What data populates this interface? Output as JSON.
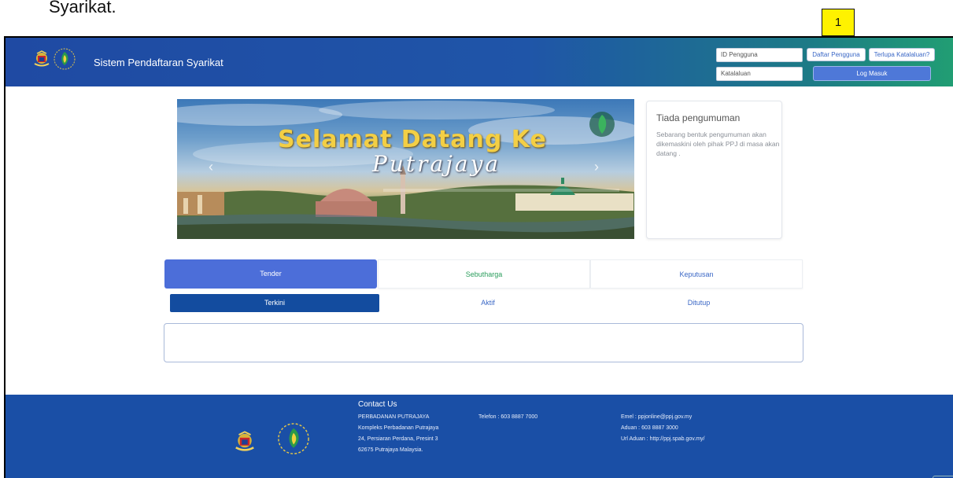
{
  "document": {
    "caption": "Syarikat."
  },
  "callout": {
    "number": "1"
  },
  "header": {
    "app_title": "Sistem Pendaftaran Syarikat",
    "user_id_placeholder": "ID Pengguna",
    "password_placeholder": "Katalaluan",
    "register_label": "Daftar Pengguna",
    "forgot_label": "Terlupa Katalaluan?",
    "login_label": "Log Masuk"
  },
  "banner": {
    "headline": "Selamat Datang Ke",
    "script": "Putrajaya",
    "prev_icon": "chevron-left-icon",
    "next_icon": "chevron-right-icon"
  },
  "announcement": {
    "title": "Tiada pengumuman",
    "body": "Sebarang bentuk pengumuman akan dikemaskini oleh pihak PPJ di masa akan datang ."
  },
  "tabs": [
    {
      "label": "Tender",
      "active": true
    },
    {
      "label": "Sebutharga",
      "active": false
    },
    {
      "label": "Keputusan",
      "active": false
    }
  ],
  "subtabs": [
    {
      "label": "Terkini",
      "active": true
    },
    {
      "label": "Aktif",
      "active": false
    },
    {
      "label": "Ditutup",
      "active": false
    }
  ],
  "footer": {
    "contact_title": "Contact Us",
    "address": [
      "PERBADANAN PUTRAJAYA",
      "Kompleks Perbadanan Putrajaya",
      "24, Persiaran Perdana, Presint 3",
      "62675 Putrajaya Malaysia."
    ],
    "telefon": "Telefon : 603 8887 7000",
    "emel": "Emel : ppjonline@ppj.gov.my",
    "aduan": "Aduan : 603 8887 3000",
    "url_aduan": "Url Aduan : http://ppj.spab.gov.my/"
  },
  "colors": {
    "header_start": "#1f4aa3",
    "header_end": "#219e73",
    "accent_blue": "#4c6ed9",
    "subtab_active": "#134c9f",
    "tab_green_text": "#2a9d5c",
    "footer": "#1a4fa6",
    "callout": "#fff200"
  }
}
